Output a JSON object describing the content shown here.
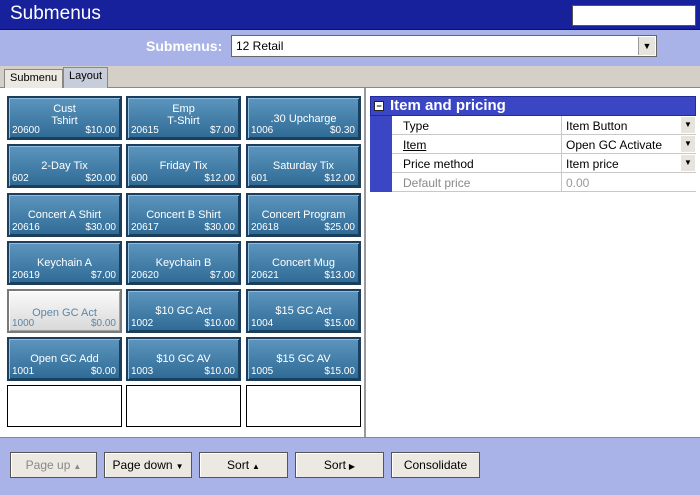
{
  "window": {
    "title": "Submenus",
    "search_value": ""
  },
  "submenu": {
    "label": "Submenus:",
    "selected": "12 Retail"
  },
  "tabs": [
    {
      "label": "Submenu",
      "active": false
    },
    {
      "label": "Layout",
      "active": true
    }
  ],
  "buttons": [
    {
      "name": "Cust\nTshirt",
      "number": "20600",
      "price": "$10.00"
    },
    {
      "name": "Emp\nT-Shirt",
      "number": "20615",
      "price": "$7.00"
    },
    {
      "name": ".30 Upcharge",
      "number": "1006",
      "price": "$0.30"
    },
    {
      "name": "2-Day Tix",
      "number": "602",
      "price": "$20.00"
    },
    {
      "name": "Friday Tix",
      "number": "600",
      "price": "$12.00"
    },
    {
      "name": "Saturday Tix",
      "number": "601",
      "price": "$12.00"
    },
    {
      "name": "Concert A Shirt",
      "number": "20616",
      "price": "$30.00"
    },
    {
      "name": "Concert B Shirt",
      "number": "20617",
      "price": "$30.00"
    },
    {
      "name": "Concert Program",
      "number": "20618",
      "price": "$25.00"
    },
    {
      "name": "Keychain A",
      "number": "20619",
      "price": "$7.00"
    },
    {
      "name": "Keychain B",
      "number": "20620",
      "price": "$7.00"
    },
    {
      "name": "Concert Mug",
      "number": "20621",
      "price": "$13.00"
    },
    {
      "name": "Open GC Act",
      "number": "1000",
      "price": "$0.00"
    },
    {
      "name": "$10 GC Act",
      "number": "1002",
      "price": "$10.00"
    },
    {
      "name": "$15 GC Act",
      "number": "1004",
      "price": "$15.00"
    },
    {
      "name": "Open GC Add",
      "number": "1001",
      "price": "$0.00"
    },
    {
      "name": "$10 GC AV",
      "number": "1003",
      "price": "$10.00"
    },
    {
      "name": "$15 GC AV",
      "number": "1005",
      "price": "$15.00"
    }
  ],
  "properties": {
    "section_title": "Item and pricing",
    "rows": [
      {
        "key": "Type",
        "value": "Item Button"
      },
      {
        "key": "Item",
        "value": "Open GC Activate"
      },
      {
        "key": "Price method",
        "value": "Item price"
      },
      {
        "key": "Default price",
        "value": "0.00"
      }
    ]
  },
  "footer": {
    "page_up": "Page up",
    "page_down": "Page down",
    "sort_up": "Sort",
    "sort_right": "Sort",
    "consolidate": "Consolidate"
  },
  "icons": {
    "collapse": "minus-box-icon",
    "dropdown": "chevron-down-icon"
  }
}
